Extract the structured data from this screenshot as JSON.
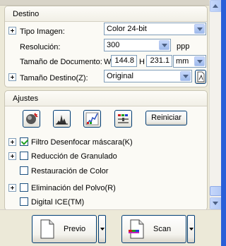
{
  "destino": {
    "title": "Destino",
    "tipo_imagen_label": "Tipo Imagen:",
    "tipo_imagen_value": "Color 24-bit",
    "resolucion_label": "Resolución:",
    "resolucion_value": "300",
    "resolucion_unit": "ppp",
    "tamano_doc_label": "Tamaño de Documento:",
    "w_label": "W",
    "w_value": "144.8",
    "h_label": "H",
    "h_value": "231.1",
    "unit_value": "mm",
    "tamano_destino_label": "Tamaño Destino(Z):",
    "tamano_destino_value": "Original"
  },
  "ajustes": {
    "title": "Ajustes",
    "reiniciar_label": "Reiniciar",
    "options": [
      {
        "label": "Filtro Desenfocar máscara(K)",
        "checked": true
      },
      {
        "label": "Reducción de Granulado",
        "checked": false
      },
      {
        "label": "Restauración de Color",
        "checked": false
      },
      {
        "label": "Eliminación del Polvo(R)",
        "checked": false
      },
      {
        "label": "Digital ICE(TM)",
        "checked": false
      }
    ]
  },
  "actions": {
    "previo_label": "Previo",
    "scan_label": "Scan"
  },
  "colors": {
    "window_bg": "#ece9d8",
    "group_bg": "#fbfaf5",
    "frame_blue": "#2a5fd8",
    "check_green": "#21a121"
  }
}
